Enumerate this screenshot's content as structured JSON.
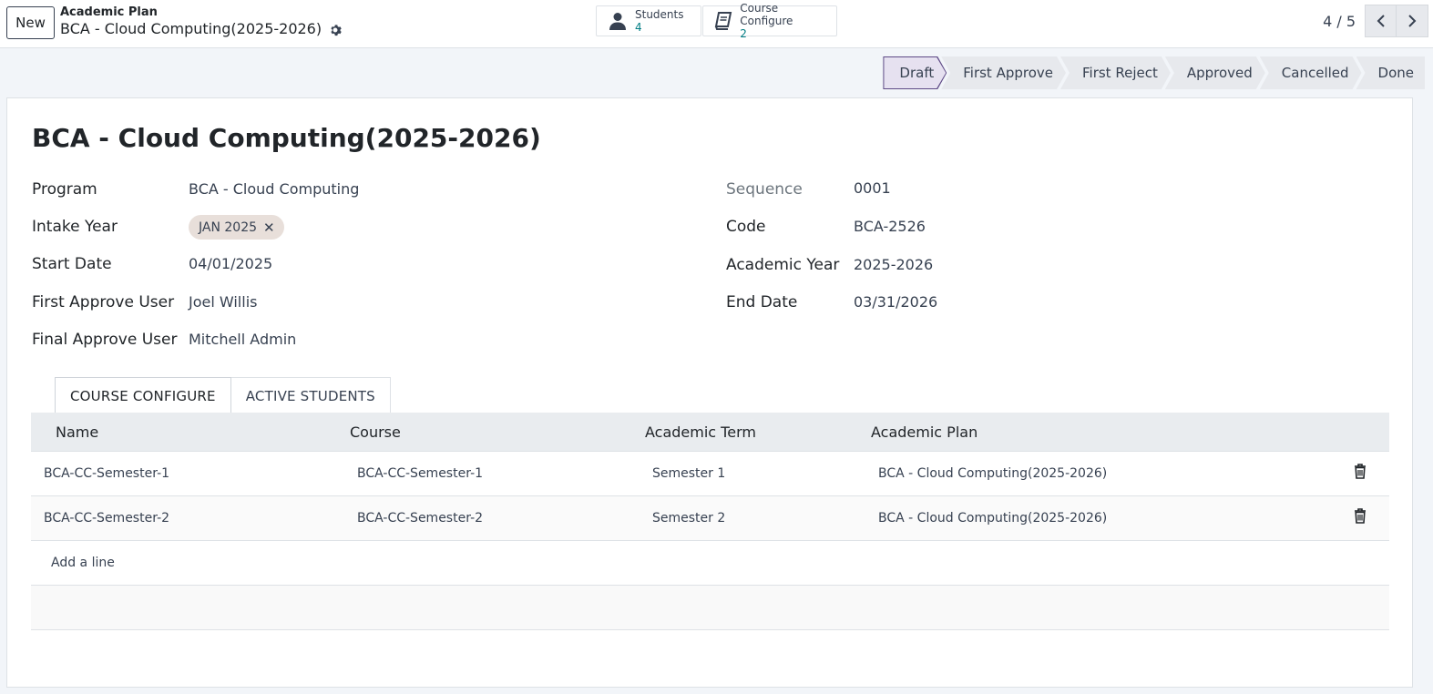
{
  "control_panel": {
    "new_label": "New",
    "breadcrumb_parent": "Academic Plan",
    "breadcrumb_current": "BCA - Cloud Computing(2025-2026)",
    "smart_buttons": [
      {
        "label": "Students",
        "value": "4",
        "icon": "user-icon"
      },
      {
        "label": "Course Configure",
        "value": "2",
        "icon": "book-icon"
      }
    ],
    "pager": {
      "value": "4 / 5"
    }
  },
  "statusbar": {
    "stages": [
      "Draft",
      "First Approve",
      "First Reject",
      "Approved",
      "Cancelled",
      "Done"
    ],
    "active": "Draft"
  },
  "form": {
    "title": "BCA - Cloud Computing(2025-2026)",
    "left_fields": [
      {
        "label": "Program",
        "value": "BCA - Cloud Computing"
      },
      {
        "label": "Intake Year",
        "tag": "JAN 2025"
      },
      {
        "label": "Start Date",
        "value": "04/01/2025"
      },
      {
        "label": "First Approve User",
        "value": "Joel Willis"
      },
      {
        "label": "Final Approve User",
        "value": "Mitchell Admin"
      }
    ],
    "right_fields": [
      {
        "label": "Sequence",
        "value": "0001"
      },
      {
        "label": "Code",
        "value": "BCA-2526"
      },
      {
        "label": "Academic Year",
        "value": "2025-2026"
      },
      {
        "label": "End Date",
        "value": "03/31/2026"
      }
    ]
  },
  "notebook": {
    "tabs": [
      "COURSE CONFIGURE",
      "ACTIVE STUDENTS"
    ],
    "active_tab": "COURSE CONFIGURE",
    "columns": [
      "Name",
      "Course",
      "Academic Term",
      "Academic Plan"
    ],
    "rows": [
      {
        "name": "BCA-CC-Semester-1",
        "course": "BCA-CC-Semester-1",
        "term": "Semester 1",
        "plan": "BCA - Cloud Computing(2025-2026)"
      },
      {
        "name": "BCA-CC-Semester-2",
        "course": "BCA-CC-Semester-2",
        "term": "Semester 2",
        "plan": "BCA - Cloud Computing(2025-2026)"
      }
    ],
    "add_line_label": "Add a line"
  },
  "colors": {
    "accent": "#017e84",
    "status_active_border": "#5e4a86",
    "status_active_bg": "#e6e1f0"
  }
}
